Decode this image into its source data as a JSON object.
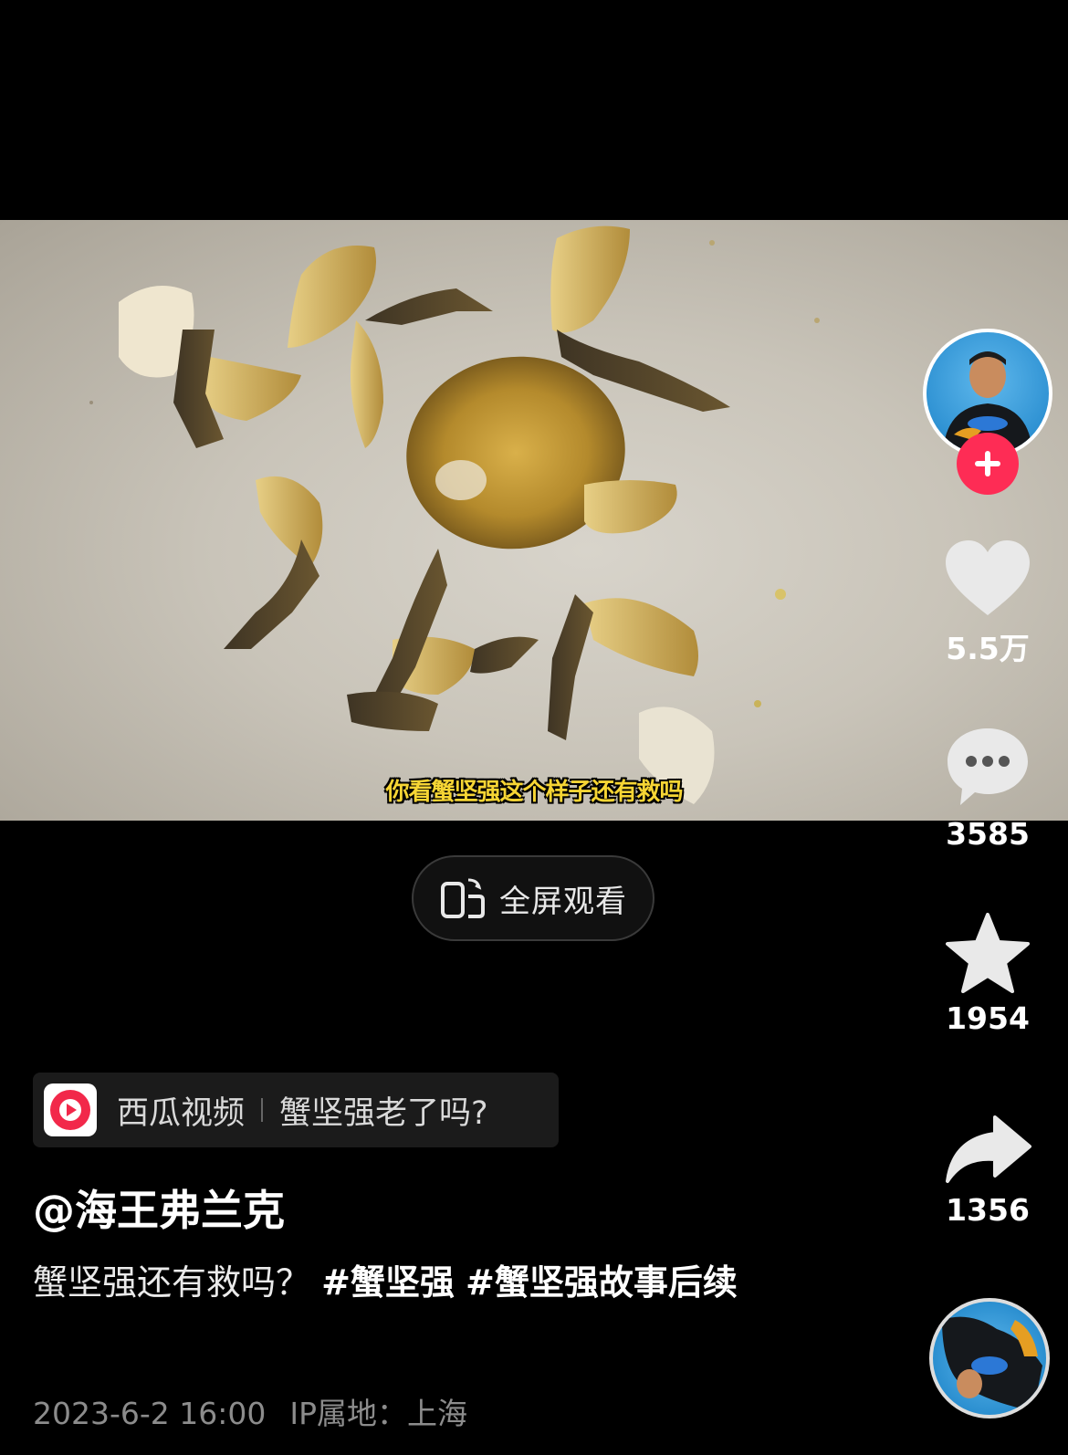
{
  "video": {
    "subtitle": "你看蟹坚强这个样子还有救吗"
  },
  "fullscreen_button": {
    "label": "全屏观看",
    "icon": "phone-rotate-icon"
  },
  "sidebar": {
    "follow_icon": "plus-icon",
    "like": {
      "icon": "heart-icon",
      "count": "5.5万"
    },
    "comment": {
      "icon": "comment-icon",
      "count": "3585"
    },
    "favorite": {
      "icon": "star-icon",
      "count": "1954"
    },
    "share": {
      "icon": "share-arrow-icon",
      "count": "1356"
    }
  },
  "source": {
    "app_name": "西瓜视频",
    "title": "蟹坚强老了吗?",
    "icon": "xigua-logo-icon"
  },
  "post": {
    "author": "@海王弗兰克",
    "caption_text": "蟹坚强还有救吗？ ",
    "tags": [
      "#蟹坚强",
      "#蟹坚强故事后续"
    ],
    "date": "2023-6-2 16:00",
    "ip_location": "IP属地：上海"
  },
  "colors": {
    "accent": "#fe2c55",
    "subtitle": "#f6d534",
    "background": "#000000"
  }
}
